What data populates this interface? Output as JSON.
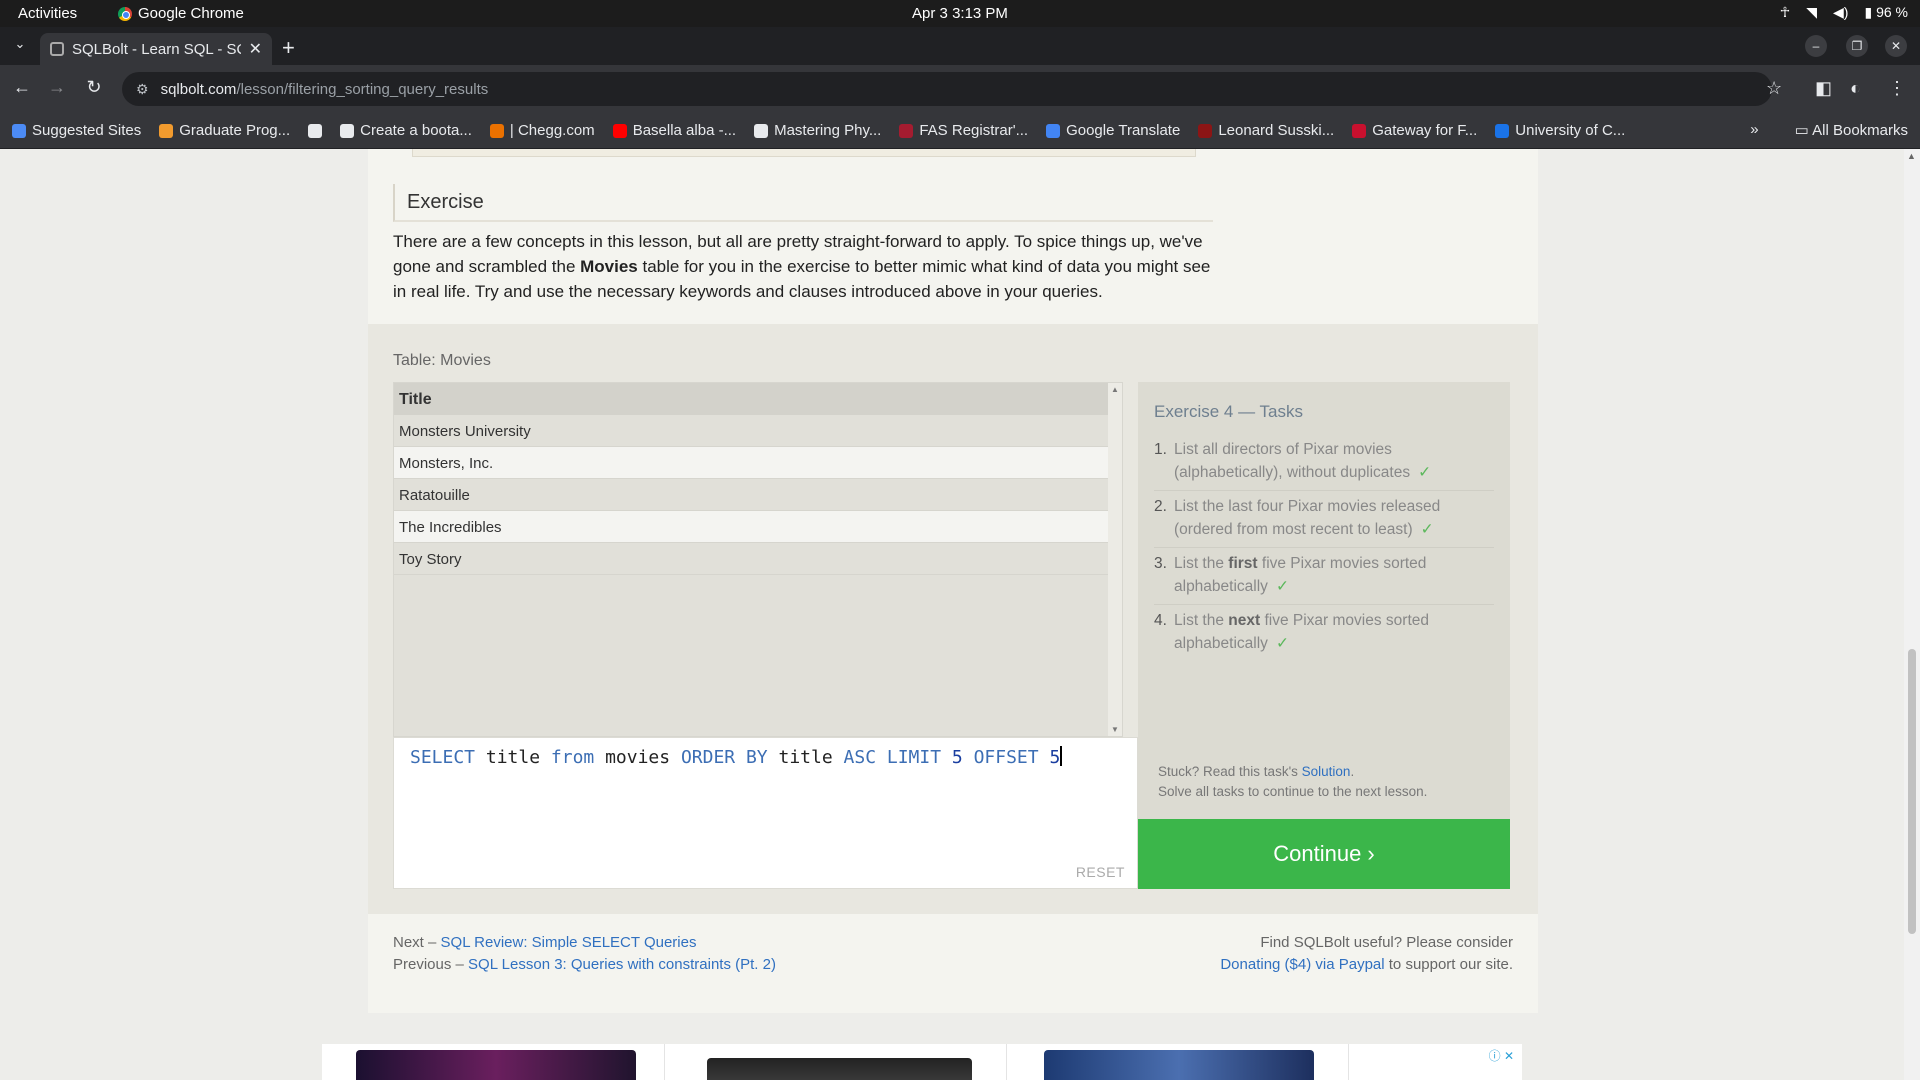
{
  "system": {
    "activities": "Activities",
    "app_name": "Google Chrome",
    "clock": "Apr 3  3:13 PM",
    "battery": "96 %"
  },
  "browser": {
    "tab_title": "SQLBolt - Learn SQL - SQ",
    "url_host": "sqlbolt.com",
    "url_path": "/lesson/filtering_sorting_query_results",
    "bookmarks": [
      {
        "label": "Suggested Sites",
        "color": "#4c8bf5"
      },
      {
        "label": "Graduate Prog...",
        "color": "#f29b2e"
      },
      {
        "label": "",
        "color": "#e8eaed"
      },
      {
        "label": "Create a boota...",
        "color": "#e8eaed"
      },
      {
        "label": "| Chegg.com",
        "color": "#eb7100"
      },
      {
        "label": "Basella alba -...",
        "color": "#ff0000"
      },
      {
        "label": "Mastering Phy...",
        "color": "#e8eaed"
      },
      {
        "label": "FAS Registrar'...",
        "color": "#a51c30"
      },
      {
        "label": "Google Translate",
        "color": "#4285f4"
      },
      {
        "label": "Leonard Susski...",
        "color": "#8c1515"
      },
      {
        "label": "Gateway for F...",
        "color": "#c8102e"
      },
      {
        "label": "University of C...",
        "color": "#1a73e8"
      }
    ],
    "more_bookmarks": "»",
    "all_bookmarks": "All Bookmarks"
  },
  "lesson": {
    "exercise_heading": "Exercise",
    "exercise_text_1": "There are a few concepts in this lesson, but all are pretty straight-forward to apply. To spice things up, we've gone and scrambled the ",
    "exercise_text_bold": "Movies",
    "exercise_text_2": " table for you in the exercise to better mimic what kind of data you might see in real life. Try and use the necessary keywords and clauses introduced above in your queries.",
    "table_label": "Table: Movies",
    "column_header": "Title",
    "rows": [
      "Monsters University",
      "Monsters, Inc.",
      "Ratatouille",
      "The Incredibles",
      "Toy Story"
    ],
    "query": {
      "t1": "SELECT",
      "t2": " title ",
      "t3": "from",
      "t4": " movies ",
      "t5": "ORDER BY",
      "t6": " title ",
      "t7": "ASC",
      "t8": " ",
      "t9": "LIMIT",
      "t10": " 5 ",
      "t11": "OFFSET",
      "t12": " 5"
    },
    "reset_label": "RESET",
    "tasks_title": "Exercise 4 — Tasks",
    "tasks": [
      {
        "num": "1.",
        "pre": "List all directors of Pixar movies (alphabetically), without duplicates",
        "bold": "",
        "post": "",
        "check": "✓"
      },
      {
        "num": "2.",
        "pre": "List the last four Pixar movies released (ordered from most recent to least)",
        "bold": "",
        "post": "",
        "check": "✓"
      },
      {
        "num": "3.",
        "pre": "List the ",
        "bold": "first",
        "post": " five Pixar movies sorted alphabetically",
        "check": "✓"
      },
      {
        "num": "4.",
        "pre": "List the ",
        "bold": "next",
        "post": " five Pixar movies sorted alphabetically",
        "check": "✓"
      }
    ],
    "stuck_text": "Stuck? Read this task's ",
    "solution_link": "Solution",
    "stuck_end": ".",
    "solve_all_text": "Solve all tasks to continue to the next lesson.",
    "continue_label": "Continue ›"
  },
  "footer": {
    "next_prefix": "Next – ",
    "next_link": "SQL Review: Simple SELECT Queries",
    "prev_prefix": "Previous – ",
    "prev_link": "SQL Lesson 3: Queries with constraints (Pt. 2)",
    "useful_text": "Find SQLBolt useful? Please consider",
    "donate_link": "Donating ($4) via Paypal",
    "donate_suffix": " to support our site."
  }
}
